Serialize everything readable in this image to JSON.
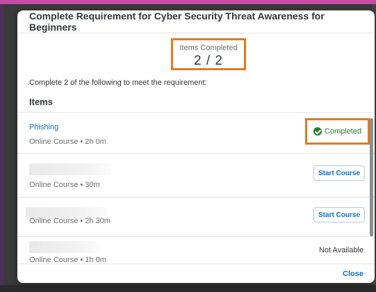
{
  "dialog": {
    "title": "Complete Requirement for Cyber Security Threat Awareness for Beginners",
    "summary": {
      "label": "Items Completed",
      "count": "2 / 2"
    },
    "instructions": "Complete 2 of the following to meet the requirement:",
    "items_heading": "Items",
    "items": [
      {
        "title": "Phishing",
        "meta": "Online Course • 2h 0m",
        "status": "Completed"
      },
      {
        "title": "",
        "meta": "Online Course • 30m",
        "action": "Start Course"
      },
      {
        "title": "",
        "meta": "Online Course • 2h 30m",
        "action": "Start Course"
      },
      {
        "title": "",
        "meta": "Online Course • 1h 0m",
        "status": "Not Available"
      }
    ],
    "close_label": "Close"
  },
  "colors": {
    "accent": "#0a6ed1",
    "success": "#2b7d2b",
    "highlight_box": "#e07a1f"
  },
  "icons": {
    "completed": "check-circle-icon"
  }
}
